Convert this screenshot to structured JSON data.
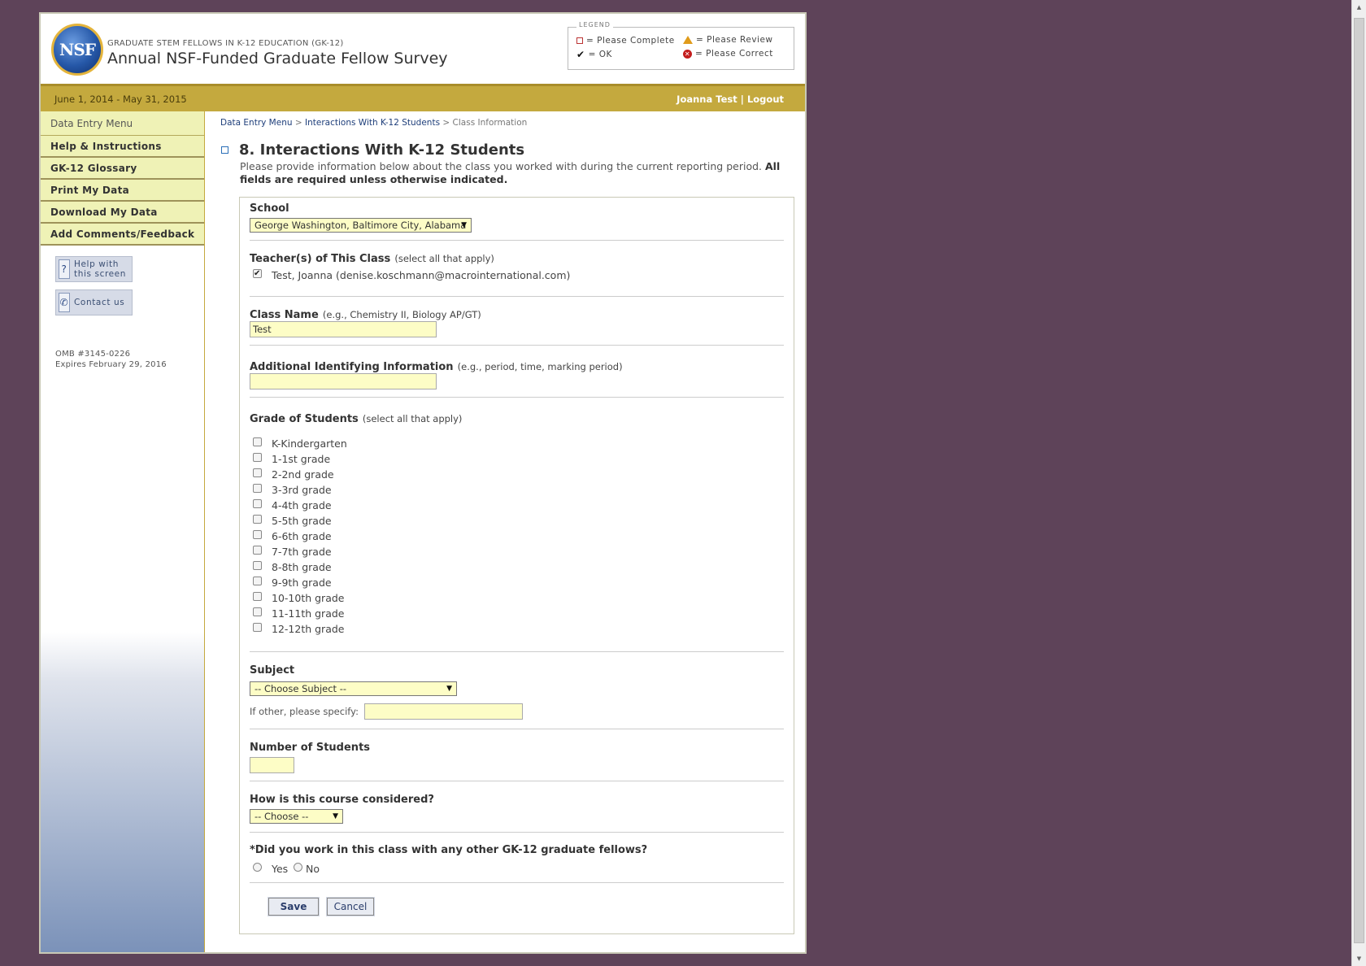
{
  "header": {
    "logo_text": "NSF",
    "program": "GRADUATE STEM FELLOWS IN K-12 EDUCATION (GK-12)",
    "title": "Annual NSF-Funded Graduate Fellow Survey",
    "legend": {
      "title": "LEGEND",
      "please_complete": "= Please Complete",
      "please_review": "= Please Review",
      "ok": "= OK",
      "please_correct": "= Please Correct"
    }
  },
  "topbar": {
    "period": "June 1, 2014 - May 31, 2015",
    "user": "Joanna Test",
    "separator": "|",
    "logout": "Logout"
  },
  "sidebar": {
    "menu_head": "Data Entry Menu",
    "items": [
      {
        "label": "Help & Instructions"
      },
      {
        "label": "GK-12 Glossary"
      },
      {
        "label": "Print My Data"
      },
      {
        "label": "Download My Data"
      },
      {
        "label": "Add Comments/Feedback"
      }
    ],
    "help_line1": "Help with",
    "help_line2": "this screen",
    "contact": "Contact us",
    "omb_line1": "OMB #3145-0226",
    "omb_line2": "Expires February 29, 2016"
  },
  "breadcrumb": {
    "item1": "Data Entry Menu",
    "sep": ">",
    "item2": "Interactions With K-12 Students",
    "item3": "Class Information"
  },
  "section": {
    "title": "8. Interactions With K-12 Students",
    "intro": "Please provide information below about the class you worked with during the current reporting period.",
    "intro_bold": "All fields are required unless otherwise indicated."
  },
  "form": {
    "school": {
      "label": "School",
      "value": "George Washington, Baltimore City, Alabama"
    },
    "teachers": {
      "label": "Teacher(s) of This Class",
      "hint": "(select all that apply)",
      "option": "Test, Joanna (denise.koschmann@macrointernational.com)",
      "checked": true
    },
    "class_name": {
      "label": "Class Name",
      "hint": "(e.g., Chemistry II, Biology AP/GT)",
      "value": "Test"
    },
    "additional": {
      "label": "Additional Identifying Information",
      "hint": "(e.g., period, time, marking period)",
      "value": ""
    },
    "grades": {
      "label": "Grade of Students",
      "hint": "(select all that apply)",
      "options": [
        "K-Kindergarten",
        "1-1st grade",
        "2-2nd grade",
        "3-3rd grade",
        "4-4th grade",
        "5-5th grade",
        "6-6th grade",
        "7-7th grade",
        "8-8th grade",
        "9-9th grade",
        "10-10th grade",
        "11-11th grade",
        "12-12th grade"
      ]
    },
    "subject": {
      "label": "Subject",
      "value": "-- Choose Subject --",
      "other_label": "If other, please specify:",
      "other_value": ""
    },
    "num_students": {
      "label": "Number of Students",
      "value": ""
    },
    "course": {
      "label": "How is this course considered?",
      "value": "-- Choose --"
    },
    "other_fellows": {
      "label": "*Did you work in this class with any other GK-12 graduate fellows?",
      "yes": "Yes",
      "no": "No"
    },
    "save": "Save",
    "cancel": "Cancel"
  }
}
